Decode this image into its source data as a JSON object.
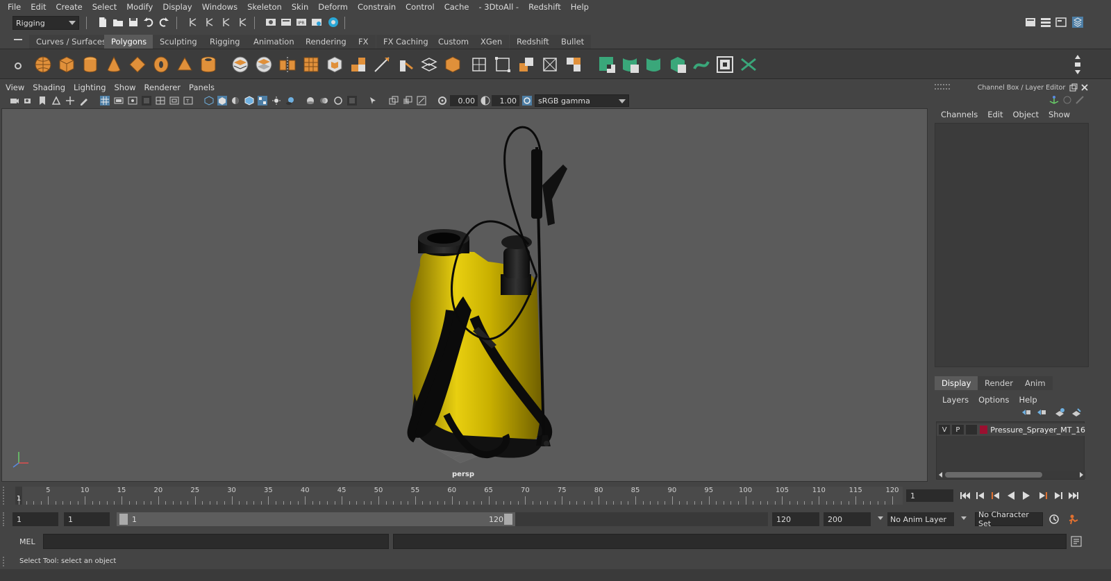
{
  "menubar": {
    "items": [
      "File",
      "Edit",
      "Create",
      "Select",
      "Modify",
      "Display",
      "Windows",
      "Skeleton",
      "Skin",
      "Deform",
      "Constrain",
      "Control",
      "Cache",
      "- 3DtoAll -",
      "Redshift",
      "Help"
    ]
  },
  "statusline": {
    "menuset": "Rigging"
  },
  "shelf": {
    "tabs": [
      "Curves / Surfaces",
      "Polygons",
      "Sculpting",
      "Rigging",
      "Animation",
      "Rendering",
      "FX",
      "FX Caching",
      "Custom",
      "XGen",
      "Redshift",
      "Bullet"
    ],
    "active_tab": "Polygons"
  },
  "viewport": {
    "menus": [
      "View",
      "Shading",
      "Lighting",
      "Show",
      "Renderer",
      "Panels"
    ],
    "exposure": "0.00",
    "gamma": "1.00",
    "color_space": "sRGB gamma",
    "camera_label": "persp"
  },
  "channel_box": {
    "title": "Channel Box / Layer Editor",
    "menus": [
      "Channels",
      "Edit",
      "Object",
      "Show"
    ]
  },
  "layer_editor": {
    "tabs": [
      "Display",
      "Render",
      "Anim"
    ],
    "active_tab": "Display",
    "menus": [
      "Layers",
      "Options",
      "Help"
    ],
    "layers": [
      {
        "visible": "V",
        "playback": "P",
        "color": "#9b1030",
        "name": "Pressure_Sprayer_MT_16"
      }
    ]
  },
  "timeslider": {
    "tick_labels": [
      "1",
      "5",
      "10",
      "15",
      "20",
      "25",
      "30",
      "35",
      "40",
      "45",
      "50",
      "55",
      "60",
      "65",
      "70",
      "75",
      "80",
      "85",
      "90",
      "95",
      "100",
      "105",
      "110",
      "115",
      "120"
    ],
    "current_frame": "1"
  },
  "rangeslider": {
    "start": "1",
    "playback_start": "1",
    "range_start_label": "1",
    "range_end_label": "120",
    "playback_end": "120",
    "end": "200",
    "anim_layer": "No Anim Layer",
    "character_set": "No Character Set"
  },
  "cmdline": {
    "language": "MEL"
  },
  "helpline": {
    "text": "Select Tool: select an object"
  }
}
